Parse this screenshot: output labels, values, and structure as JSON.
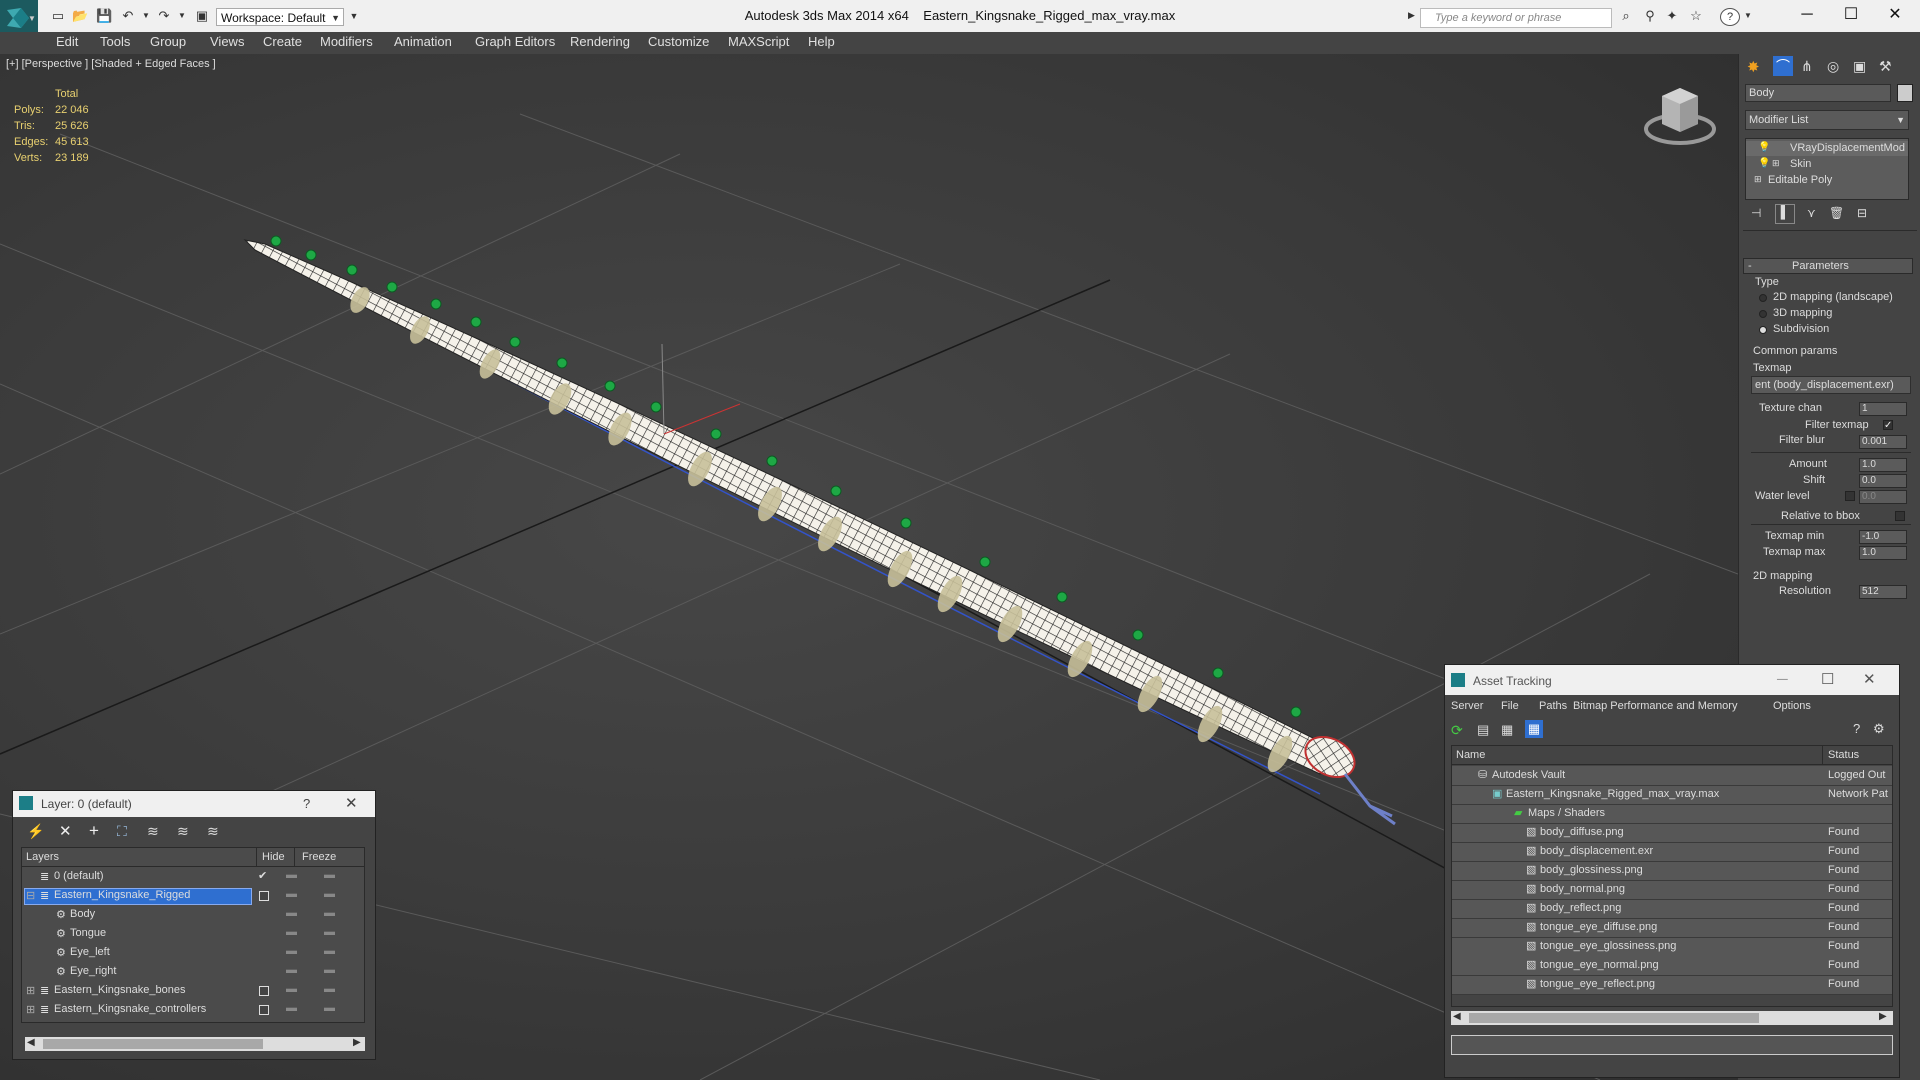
{
  "window": {
    "app_title": "Autodesk 3ds Max  2014 x64",
    "file_title": "Eastern_Kingsnake_Rigged_max_vray.max",
    "workspace": "Workspace: Default",
    "search_placeholder": "Type a keyword or phrase"
  },
  "menu": [
    "Edit",
    "Tools",
    "Group",
    "Views",
    "Create",
    "Modifiers",
    "Animation",
    "Graph Editors",
    "Rendering",
    "Customize",
    "MAXScript",
    "Help"
  ],
  "viewport": {
    "label": "[+] [Perspective ] [Shaded + Edged Faces ]",
    "stats_header": "Total",
    "stats": [
      {
        "label": "Polys:",
        "value": "22 046"
      },
      {
        "label": "Tris:",
        "value": "25 626"
      },
      {
        "label": "Edges:",
        "value": "45 613"
      },
      {
        "label": "Verts:",
        "value": "23 189"
      }
    ]
  },
  "command_panel": {
    "object_name": "Body",
    "modifier_list": "Modifier List",
    "stack": [
      "VRayDisplacementMod",
      "Skin",
      "Editable Poly"
    ],
    "rollout_title": "Parameters",
    "type_label": "Type",
    "type_options": [
      "2D mapping (landscape)",
      "3D mapping",
      "Subdivision"
    ],
    "type_selected": "Subdivision",
    "common_params": "Common params",
    "texmap_label": "Texmap",
    "texmap_value": "ent (body_displacement.exr)",
    "texture_chan_label": "Texture chan",
    "texture_chan": "1",
    "filter_texmap_label": "Filter texmap",
    "filter_blur_label": "Filter blur",
    "filter_blur": "0.001",
    "amount_label": "Amount",
    "amount": "1.0",
    "shift_label": "Shift",
    "shift": "0.0",
    "water_level_label": "Water level",
    "water_level": "0.0",
    "relative_bbox_label": "Relative to bbox",
    "texmap_min_label": "Texmap min",
    "texmap_min": "-1.0",
    "texmap_max_label": "Texmap max",
    "texmap_max": "1.0",
    "mapping_2d_label": "2D mapping",
    "resolution_label": "Resolution",
    "resolution": "512"
  },
  "layer_dialog": {
    "title": "Layer: 0 (default)",
    "help": "?",
    "col_layers": "Layers",
    "col_hide": "Hide",
    "col_freeze": "Freeze",
    "rows": [
      {
        "name": "0 (default)",
        "level": 0
      },
      {
        "name": "Eastern_Kingsnake_Rigged",
        "level": 0,
        "selected": true
      },
      {
        "name": "Body",
        "level": 1
      },
      {
        "name": "Tongue",
        "level": 1
      },
      {
        "name": "Eye_left",
        "level": 1
      },
      {
        "name": "Eye_right",
        "level": 1
      },
      {
        "name": "Eastern_Kingsnake_bones",
        "level": 0
      },
      {
        "name": "Eastern_Kingsnake_controllers",
        "level": 0
      }
    ]
  },
  "asset_tracking": {
    "title": "Asset Tracking",
    "menu": [
      "Server",
      "File",
      "Paths",
      "Bitmap Performance and Memory",
      "Options"
    ],
    "col_name": "Name",
    "col_status": "Status",
    "rows": [
      {
        "name": "Autodesk Vault",
        "status": "Logged Out",
        "indent": 1
      },
      {
        "name": "Eastern_Kingsnake_Rigged_max_vray.max",
        "status": "Network Pat",
        "indent": 2
      },
      {
        "name": "Maps / Shaders",
        "status": "",
        "indent": 3
      },
      {
        "name": "body_diffuse.png",
        "status": "Found",
        "indent": 4
      },
      {
        "name": "body_displacement.exr",
        "status": "Found",
        "indent": 4
      },
      {
        "name": "body_glossiness.png",
        "status": "Found",
        "indent": 4
      },
      {
        "name": "body_normal.png",
        "status": "Found",
        "indent": 4
      },
      {
        "name": "body_reflect.png",
        "status": "Found",
        "indent": 4
      },
      {
        "name": "tongue_eye_diffuse.png",
        "status": "Found",
        "indent": 4
      },
      {
        "name": "tongue_eye_glossiness.png",
        "status": "Found",
        "indent": 4
      },
      {
        "name": "tongue_eye_normal.png",
        "status": "Found",
        "indent": 4
      },
      {
        "name": "tongue_eye_reflect.png",
        "status": "Found",
        "indent": 4
      }
    ]
  },
  "colors": {
    "accent": "#2f6fd0",
    "stats": "#e8d070",
    "viewport_bg": "#3a3a3a"
  }
}
